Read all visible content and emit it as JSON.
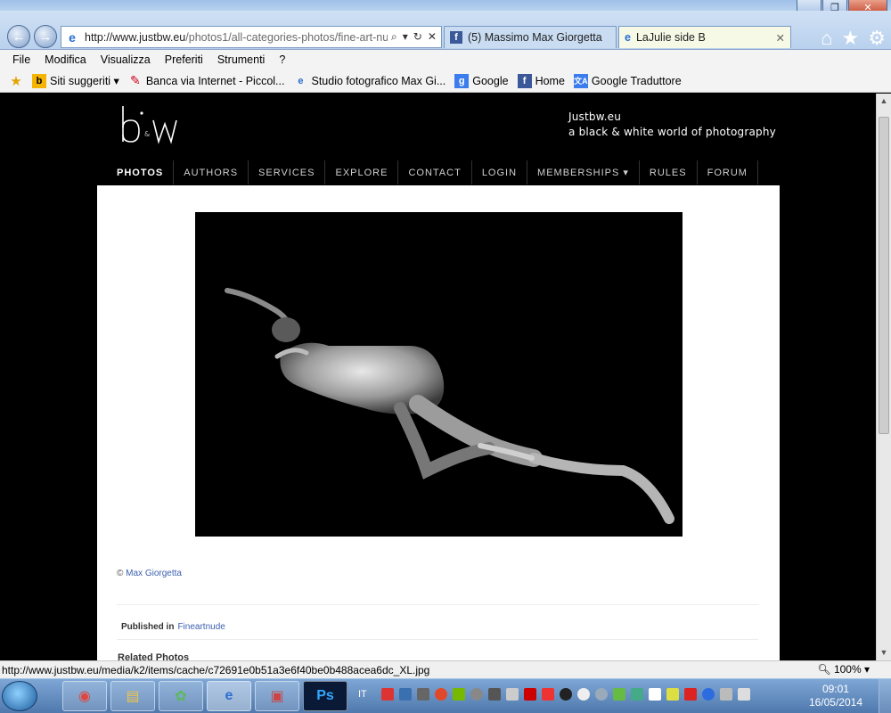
{
  "browser": {
    "url_domain": "http://www.justbw.eu",
    "url_path": "/photos1/all-categories-photos/fine-art-nuc",
    "tabs": [
      {
        "label": "(5) Massimo Max Giorgetta",
        "icon": "facebook-icon",
        "active": false
      },
      {
        "label": "LaJulie side B",
        "icon": "ie-icon",
        "active": true
      }
    ],
    "menu": [
      "File",
      "Modifica",
      "Visualizza",
      "Preferiti",
      "Strumenti",
      "?"
    ],
    "favorites": [
      {
        "label": "Siti suggeriti ▾",
        "icon": "bing-icon",
        "color": "#f4b400"
      },
      {
        "label": "Banca via Internet - Piccol...",
        "icon": "bank-icon",
        "color": "#d0021b"
      },
      {
        "label": "Studio fotografico Max Gi...",
        "icon": "ie-icon",
        "color": "#2a6fd0"
      },
      {
        "label": "Google",
        "icon": "google-icon",
        "color": "#3b7ded"
      },
      {
        "label": "Home",
        "icon": "facebook-icon",
        "color": "#3b5998"
      },
      {
        "label": "Google Traduttore",
        "icon": "translate-icon",
        "color": "#3b7ded"
      }
    ],
    "status_url": "http://www.justbw.eu/media/k2/items/cache/c72691e0b51a3e6f40be0b488acea6dc_XL.jpg",
    "zoom": "100%"
  },
  "site": {
    "tagline_line1": "Justbw.eu",
    "tagline_line2": "a black & white world of photography",
    "nav": [
      "PHOTOS",
      "AUTHORS",
      "SERVICES",
      "EXPLORE",
      "CONTACT",
      "LOGIN",
      "MEMBERSHIPS ▾",
      "RULES",
      "FORUM"
    ],
    "active_nav": 0
  },
  "article": {
    "copyright_symbol": "©",
    "author": "Max Giorgetta",
    "published_label": "Published in",
    "category": "Fineartnude",
    "related_heading": "Related Photos"
  },
  "taskbar": {
    "lang": "IT",
    "time": "09:01",
    "date": "16/05/2014"
  }
}
